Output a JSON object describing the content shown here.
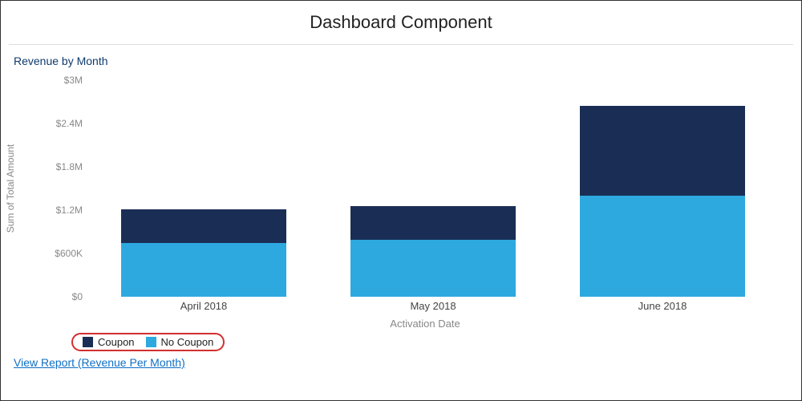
{
  "header": {
    "title": "Dashboard Component"
  },
  "chart": {
    "title": "Revenue by Month",
    "ylabel": "Sum of Total Amount",
    "xlabel": "Activation Date",
    "yticks": [
      "$0",
      "$600K",
      "$1.2M",
      "$1.8M",
      "$2.4M",
      "$3M"
    ],
    "categories": [
      "April 2018",
      "May 2018",
      "June 2018"
    ],
    "legend": {
      "coupon": "Coupon",
      "nocoupon": "No Coupon"
    }
  },
  "link": {
    "label": "View Report (Revenue Per Month)"
  },
  "colors": {
    "coupon": "#1a2e55",
    "nocoupon": "#2ea9e0"
  },
  "chart_data": {
    "type": "bar",
    "stacked": true,
    "title": "Revenue by Month",
    "xlabel": "Activation Date",
    "ylabel": "Sum of Total Amount",
    "ylim": [
      0,
      3000000
    ],
    "categories": [
      "April 2018",
      "May 2018",
      "June 2018"
    ],
    "series": [
      {
        "name": "No Coupon",
        "values": [
          740000,
          790000,
          1400000
        ]
      },
      {
        "name": "Coupon",
        "values": [
          470000,
          470000,
          1240000
        ]
      }
    ],
    "legend_position": "bottom-left"
  }
}
